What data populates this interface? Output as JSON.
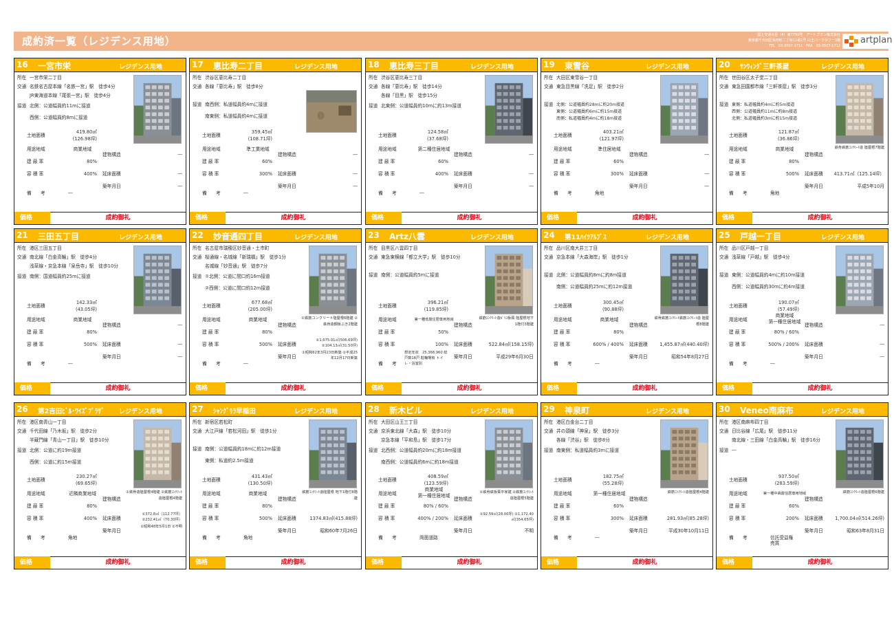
{
  "page": {
    "title": "成約済一覧（レジデンス用地）",
    "company_lines": [
      "国土交通大臣（4）第7759号　アートプラン株式会社",
      "東京都千代田区永田町二丁目11番1号 山王パークタワー3階",
      "TEL　03-3507-1711　FAX　03-3507-1712"
    ],
    "logo_text": "artplan"
  },
  "labels": {
    "address": "所在",
    "transit": "交通",
    "road": "接道",
    "land_area": "土地面積",
    "zoning": "用途地域",
    "coverage": "建 蔽 率",
    "far": "容 積 率",
    "remarks": "備　　考",
    "structure": "建物構造",
    "floor_area": "延床面積",
    "built": "築年月日",
    "price": "価格",
    "category": "レジデンス用地",
    "price_value": "成約御礼"
  },
  "colors": {
    "accent": "#fbb900",
    "header": "#f2b48a",
    "price_text": "#e60012"
  },
  "cards": [
    {
      "num": "16",
      "name": "一宮市栄",
      "address": "一宮市栄二丁目",
      "transit": [
        "名鉄名古屋本線「名鉄一宮」駅　徒歩4分",
        "JR東海道本線「尾張一宮」駅　徒歩4分"
      ],
      "road": [
        "北側：公道幅員約11mに接道",
        "西側：公道幅員約8mに接道"
      ],
      "land_area": "419.80㎡",
      "land_tsubo": "(126.98坪)",
      "zoning": [
        "商業地域"
      ],
      "coverage": "80%",
      "far": "400%",
      "remarks": "―",
      "structure": "―",
      "floor_area": "―",
      "built": "―"
    },
    {
      "num": "17",
      "name": "恵比寿二丁目",
      "address": "渋谷区恵比寿二丁目",
      "transit": [
        "各線「恵比寿」駅　徒歩8分"
      ],
      "road": [
        "南西側：私道幅員約4mに接道",
        "南東側：私道幅員約4mに接道"
      ],
      "land_area": "359.45㎡",
      "land_tsubo": "(108.71坪)",
      "zoning": [
        "準工業地域"
      ],
      "coverage": "60%",
      "far": "300%",
      "remarks": "―",
      "structure": "―",
      "floor_area": "―",
      "built": "―"
    },
    {
      "num": "18",
      "name": "恵比寿三丁目",
      "address": "渋谷区恵比寿三丁目",
      "transit": [
        "各線「恵比寿」駅　徒歩14分",
        "各線「目黒」駅　徒歩15分"
      ],
      "road": [
        "北東側：公道幅員約10mに約13m接道"
      ],
      "land_area": "124.58㎡",
      "land_tsubo": "(37.68坪)",
      "zoning": [
        "第二種住居地域"
      ],
      "coverage": "60%",
      "far": "400%",
      "remarks": "―",
      "structure": "―",
      "floor_area": "―",
      "built": "―"
    },
    {
      "num": "19",
      "name": "東雪谷",
      "address": "大田区東雪谷一丁目",
      "transit": [
        "東急目黒線「洗足」駅　徒歩2分"
      ],
      "road": [
        "北側：公道幅員約28mに約20m接道",
        "東側：公道幅員約6mに約15m接道",
        "南側：私道幅員約4mに約18m接道"
      ],
      "land_area": "403.21㎡",
      "land_tsubo": "(121.97坪)",
      "zoning": [
        "準住居地域"
      ],
      "coverage": "60%",
      "far": "300%",
      "remarks": "角地",
      "structure": "―",
      "floor_area": "―",
      "built": "―"
    },
    {
      "num": "20",
      "name": "ｻﾝｳｨﾝｸﾞ三軒茶屋",
      "address": "世田谷区太子堂二丁目",
      "transit": [
        "東急田園都市線「三軒茶屋」駅　徒歩3分"
      ],
      "road": [
        "東側：私道幅員約4mに約5m接道",
        "西側：公道幅員約11mに約8m接道",
        "北側：私道幅員約3mに約15m接道"
      ],
      "land_area": "121.87㎡",
      "land_tsubo": "(36.86坪)",
      "zoning": [
        "商業地域"
      ],
      "coverage": "80%",
      "far": "500%",
      "remarks": "角地",
      "structure": "鉄骨鉄筋ｺﾝｸﾘｰﾄ造 陸屋根7階建",
      "floor_area": "413.71㎡（125.14坪）",
      "built": "平成5年10月"
    },
    {
      "num": "21",
      "name": "三田五丁目",
      "address": "港区三田五丁目",
      "transit": [
        "南北線「白金高輪」駅　徒歩4分",
        "浅草線・京急本線「泉岳寺」駅　徒歩10分"
      ],
      "road": [
        "南側：国道幅員約25mに接道"
      ],
      "land_area": "142.33㎡",
      "land_tsubo": "(43.05坪)",
      "zoning": [
        "商業地域"
      ],
      "coverage": "80%",
      "far": "500%",
      "remarks": "―",
      "structure": "―",
      "floor_area": "―",
      "built": "―"
    },
    {
      "num": "22",
      "name": "妙音通四丁目",
      "address": "名古屋市瑞穂区妙音通・土市町",
      "transit": [
        "桜通線・名城線「新瑞橋」駅　徒歩1分",
        "名城線「妙音通」駅　徒歩7分"
      ],
      "road": [
        "①北側：公道に間口約16m接道",
        "②西側：公道に間口約12m接道"
      ],
      "land_area": "677.68㎡",
      "land_tsubo": "(205.00坪)",
      "zoning": [
        "商業地域"
      ],
      "coverage": "80%",
      "far": "500%",
      "remarks": "―",
      "structure": "①鉄筋コンクリート陸屋根6階建 ②鉄骨造鋼板ぶき2階建",
      "floor_area": "①1,675.01㎡(506.69坪) ②104.13㎡(31.50坪)",
      "built": "①昭和62年3月23日新築 ②平成25年12月17日新築"
    },
    {
      "num": "23",
      "name": "Artz八雲",
      "address": "目黒区八雲四丁目",
      "transit": [
        "東急東横線「都立大学」駅　徒歩10分"
      ],
      "road": [
        "南側：公道幅員約5mに接道"
      ],
      "land_area": "396.21㎡",
      "land_tsubo": "(119.85坪)",
      "zoning": [
        "第一種低層住居専用地域"
      ],
      "coverage": "50%",
      "far": "100%",
      "remarks": "想定年収　25,368,960 総戸数18戸 駐輪場有 トイレ・浴室別",
      "structure": "鉄筋ｺﾝｸﾘｰﾄ造ｶﾞﾗｽ板葺 陸屋根地下1階付3階建",
      "floor_area": "522.84㎡(158.15坪)",
      "built": "平成29年6月30日"
    },
    {
      "num": "24",
      "name": "第11ﾊｲﾂｱﾙﾌﾟｽ",
      "address": "品川区南大井三丁目",
      "transit": [
        "京急本線「大森海岸」駅　徒歩1分"
      ],
      "road": [
        "北側：公道幅員約8mに約8m接道",
        "南側：公道幅員約25mに約12m接道"
      ],
      "land_area": "300.45㎡",
      "land_tsubo": "(90.88坪)",
      "zoning": [
        "商業地域"
      ],
      "coverage": "80%",
      "far": "600% / 400%",
      "remarks": "―",
      "structure": "鉄骨鉄筋ｺﾝｸﾘｰﾄ鉄筋ｺﾝｸﾘｰﾄ造 陸屋根8階建",
      "floor_area": "1,455.87㎡(440.40坪)",
      "built": "昭和54年8月27日"
    },
    {
      "num": "25",
      "name": "戸越一丁目",
      "address": "品川区戸越一丁目",
      "transit": [
        "浅草線「戸越」駅　徒歩4分"
      ],
      "road": [
        "東側：公道幅員約4mに約10m接道",
        "西側：公道幅員約30mに約4m接道"
      ],
      "land_area": "190.07㎡",
      "land_tsubo": "(57.49坪)",
      "zoning": [
        "商業地域",
        "第一種住居地域"
      ],
      "coverage": "80% / 60%",
      "far": "500% / 200%",
      "remarks": "―",
      "structure": "―",
      "floor_area": "―",
      "built": "―"
    },
    {
      "num": "26",
      "name": "第2吉田ﾋﾞﾙ･ﾜｲｽﾞﾌﾟﾗｻﾞ",
      "address": "港区南青山一丁目",
      "transit": [
        "千代田線「乃木坂」駅　徒歩2分",
        "半蔵門線「青山一丁目」駅　徒歩10分"
      ],
      "road": [
        "北側：公道に約19m接道",
        "西側：公道に約15m接道"
      ],
      "land_area": "230.27㎡",
      "land_tsubo": "(69.65坪)",
      "zoning": [
        "近隣商業地域"
      ],
      "coverage": "80%",
      "far": "400%",
      "remarks": "角地",
      "structure": "①鉄骨造陸屋根4階建 ②鉄筋ｺﾝｸﾘｰﾄ造陸屋根4階建",
      "floor_area": "①372.8㎡（112.77坪） ②232.41㎡（70.30坪）",
      "built": "①昭和48年5月1日 ②不明"
    },
    {
      "num": "27",
      "name": "ｼｬﾝｸﾞﾘﾗ早稲田",
      "address": "新宿区若松町",
      "transit": [
        "大江戸線「若松河田」駅　徒歩1分"
      ],
      "road": [
        "南側：公道幅員約18mに約12m接道",
        "東側：私道約2.5m接道"
      ],
      "land_area": "431.43㎡",
      "land_tsubo": "(130.50坪)",
      "zoning": [
        "商業地域"
      ],
      "coverage": "80%",
      "far": "500%",
      "remarks": "角地",
      "structure": "鉄筋ｺﾝｸﾘｰﾄ造陸屋根 地下1階付8階建",
      "floor_area": "1374.83㎡(415.88坪)",
      "built": "昭和60年7月26日"
    },
    {
      "num": "28",
      "name": "新木ビル",
      "address": "大田区山王三丁目",
      "transit": [
        "京浜東北線「大森」駅　徒歩10分",
        "京急本線「平和島」駅　徒歩17分"
      ],
      "road": [
        "北西側：公道幅員約20mに約18m接道",
        "南西側：公道幅員約6mに約18m接道"
      ],
      "land_area": "408.59㎡",
      "land_tsubo": "(123.59坪)",
      "zoning": [
        "商業地域",
        "第一種住居地域"
      ],
      "coverage": "80% / 60%",
      "far": "400% / 200%",
      "remarks": "両面道路",
      "structure": "①鉄骨鉄板葺平家建 ②鉄筋ｺﾝｸﾘｰﾄ造陸屋根5階建",
      "floor_area": "①92.59㎡(28.00坪) ②1,172.40㎡(354.65坪)",
      "built": "不明"
    },
    {
      "num": "29",
      "name": "神泉町",
      "address": "港区白金台二丁目",
      "transit": [
        "井の頭線「神泉」駅　徒歩3分",
        "各線「渋谷」駅　徒歩8分"
      ],
      "road": [
        "南東側：私道幅員約3mに接道"
      ],
      "land_area": "182.75㎡",
      "land_tsubo": "(55.28坪)",
      "zoning": [
        "第一種住居地域"
      ],
      "coverage": "60%",
      "far": "300%",
      "remarks": "―",
      "structure": "鉄筋ｺﾝｸﾘｰﾄ造陸屋根4階建",
      "floor_area": "281.93㎡(85.28坪)",
      "built": "平成30年10月11日"
    },
    {
      "num": "30",
      "name": "Veneo南麻布",
      "address": "港区南麻布四丁目",
      "transit": [
        "日比谷線「広尾」駅　徒歩11分",
        "南北線・三田線「白金高輪」駅　徒歩16分"
      ],
      "road": [
        "―"
      ],
      "land_area": "937.50㎡",
      "land_tsubo": "(283.59坪)",
      "zoning": [
        "第一種中高層住居専用地域"
      ],
      "coverage": "60%",
      "far": "200%",
      "remarks": "信託受益権売買",
      "structure": "鉄筋ｺﾝｸﾘｰﾄ造陸屋根6階建",
      "floor_area": "1,700.04㎡(514.26坪)",
      "built": "昭和63年8月31日"
    }
  ]
}
